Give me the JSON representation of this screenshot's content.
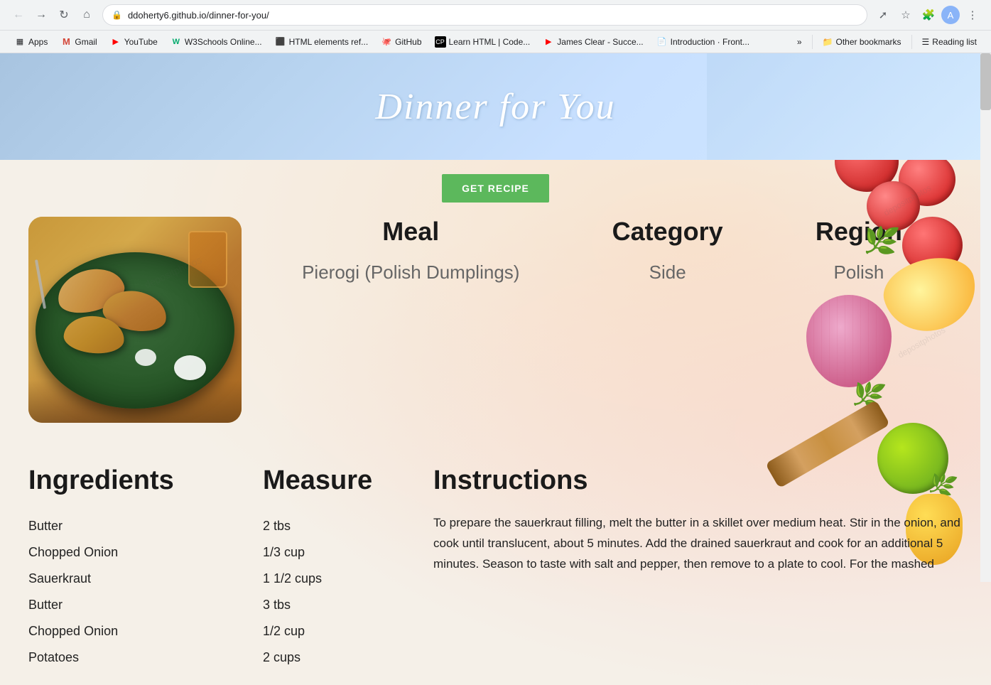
{
  "browser": {
    "url": "ddoherty6.github.io/dinner-for-you/",
    "back_btn": "←",
    "forward_btn": "→",
    "reload_btn": "↻",
    "home_btn": "⌂",
    "bookmark_star": "☆",
    "extensions_icon": "🧩",
    "menu_icon": "⋮"
  },
  "bookmarks": {
    "items": [
      {
        "label": "Apps",
        "favicon": "🔲"
      },
      {
        "label": "Gmail",
        "favicon": "M"
      },
      {
        "label": "YouTube",
        "favicon": "▶"
      },
      {
        "label": "W3Schools Online...",
        "favicon": "W"
      },
      {
        "label": "HTML elements ref...",
        "favicon": "⬛"
      },
      {
        "label": "GitHub",
        "favicon": "🐙"
      },
      {
        "label": "Learn HTML | Code...",
        "favicon": "⬛"
      },
      {
        "label": "James Clear - Succe...",
        "favicon": "▶"
      },
      {
        "label": "Introduction · Front...",
        "favicon": "📄"
      }
    ],
    "more_label": "»",
    "other_bookmarks_label": "Other bookmarks",
    "reading_list_label": "Reading list"
  },
  "page": {
    "title": "Dinner for You",
    "get_recipe_btn": "GET RECIPE",
    "meal": {
      "label": "Meal",
      "value": "Pierogi (Polish Dumplings)"
    },
    "category": {
      "label": "Category",
      "value": "Side"
    },
    "region": {
      "label": "Region",
      "value": "Polish"
    },
    "ingredients_header": "Ingredients",
    "measure_header": "Measure",
    "instructions_header": "Instructions",
    "ingredients": [
      "Butter",
      "Chopped Onion",
      "Sauerkraut",
      "Butter",
      "Chopped Onion",
      "Potatoes"
    ],
    "measures": [
      "2 tbs",
      "1/3 cup",
      "1 1/2 cups",
      "3 tbs",
      "1/2 cup",
      "2 cups"
    ],
    "instructions": "To prepare the sauerkraut filling, melt the butter in a skillet over medium heat. Stir in the onion, and cook until translucent, about 5 minutes. Add the drained sauerkraut and cook for an additional 5 minutes. Season to taste with salt and pepper, then remove to a plate to cool. For the mashed"
  }
}
